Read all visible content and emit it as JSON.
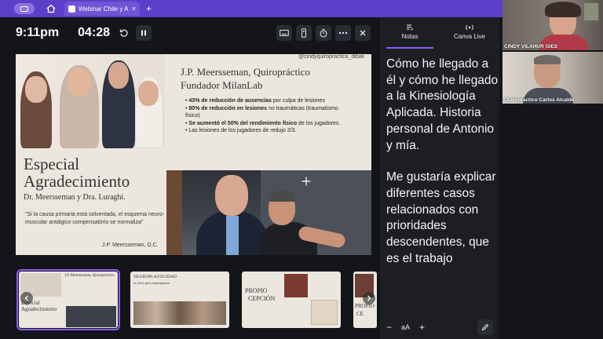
{
  "browser": {
    "tab_title": "Webinar Chile y Ar...",
    "close": "×",
    "new_tab": "+"
  },
  "presenter": {
    "clock": "9:11pm",
    "timer": "04:28"
  },
  "slide": {
    "handle": "@cindyquiropractica_dibak",
    "title_line1": "J.P. Meersseman, Quiropráctico",
    "title_line2": "Fundador MilanLab",
    "bullets": [
      {
        "bold": "43% de reducción de ausencias",
        "rest": " por culpa de lesiones"
      },
      {
        "bold": "80% de reducción en lesiones",
        "rest": " no traumáticas (traumatismo físico)"
      },
      {
        "bold": "Se aumentó el 50% del rendimiento físico",
        "rest": " de los jugadores."
      },
      {
        "bold": "",
        "rest": "Las lesiones de los jugadores de reduj⁠o 2/3."
      }
    ],
    "heading1": "Especial",
    "heading2": "Agradecimiento",
    "heading3": "Dr. Meersseman y Dra. Luraghi.",
    "quote": "\"Si la causa primaria está solventada, el esquema neuro- muscular antálgico compensatório se normaliza\"",
    "signature": "J.P. Meersseman, D.C."
  },
  "thumbnails": [
    {
      "title1": "J.P. Meersseman, Quiropráctico",
      "title2": "Especial Agradecimiento"
    },
    {
      "title1": "NEUROPLASTICIDAD",
      "title2": "la clave para reprogramar"
    },
    {
      "title1": "PROPIO",
      "title2": "CEPCIÓN"
    },
    {
      "title1": "PROPIO",
      "title2": "CE"
    }
  ],
  "notes": {
    "tab_notes": "Notas",
    "tab_live": "Canva Live",
    "para1": "Cómo he llegado a él y cómo he llegado a la Kinesiología Aplicada. Historia personal de Antonio y mía.",
    "para2": "Me gustaría explicar diferentes casos relacionados con prioridades descendentes, que es el trabajo",
    "minus": "−",
    "font_size": "aA",
    "plus": "+"
  },
  "participants": [
    {
      "name": "CINDY VILAHUR GIES"
    },
    {
      "name": "Quiropractico Carlos Alcalde"
    }
  ],
  "colors": {
    "accent": "#8b5cf6",
    "chrome": "#5b3fc8"
  }
}
